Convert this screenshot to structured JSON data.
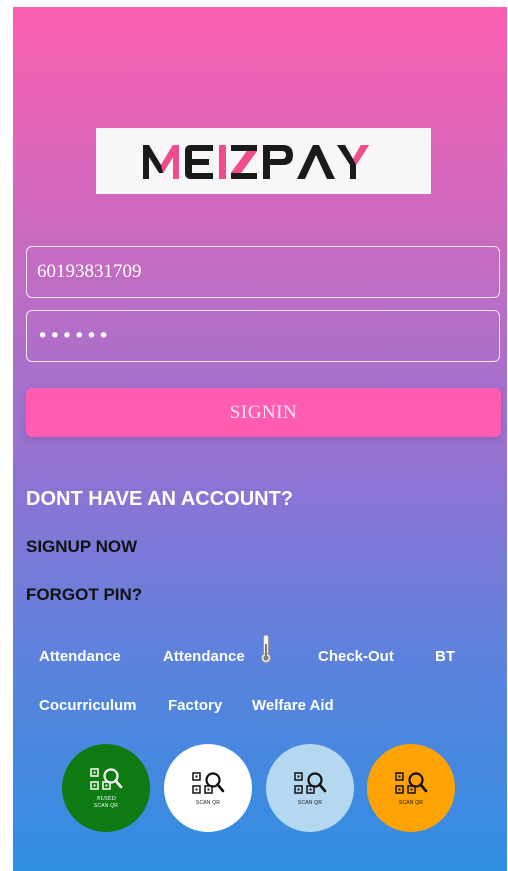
{
  "app": {
    "logo_text": "MEIZPAY",
    "logo_colors": {
      "dark": "#1a1a1a",
      "accent": "#f24c8f",
      "background": "#f8f6f8"
    }
  },
  "login": {
    "phone_value": "60193831709",
    "pin_value": "••••••",
    "signin_label": "SIGNIN"
  },
  "links": {
    "no_account": "DONT HAVE AN ACCOUNT?",
    "signup": "SIGNUP NOW",
    "forgot_pin": "FORGOT PIN?"
  },
  "quick_links": [
    {
      "label": "Attendance"
    },
    {
      "label": "Attendance",
      "icon": "thermometer-icon"
    },
    {
      "label": "Check-Out"
    },
    {
      "label": "BT"
    },
    {
      "label": "Cocurriculum"
    },
    {
      "label": "Factory"
    },
    {
      "label": "Welfare Aid"
    }
  ],
  "scan_buttons": [
    {
      "label": "SCAN QR",
      "sub_label": "NUSED",
      "color": "#0e7a12",
      "icon": "qr-search-icon"
    },
    {
      "label": "SCAN QR",
      "color": "#ffffff",
      "icon": "qr-search-icon"
    },
    {
      "label": "SCAN QR",
      "color": "#b4d8ef",
      "icon": "qr-search-icon"
    },
    {
      "label": "SCAN QR",
      "color": "#ffa304",
      "icon": "qr-search-icon"
    }
  ],
  "theme": {
    "gradient_top": "#fd5fb0",
    "gradient_bottom": "#2f8ee2",
    "button_pink": "#ff5cb2"
  }
}
